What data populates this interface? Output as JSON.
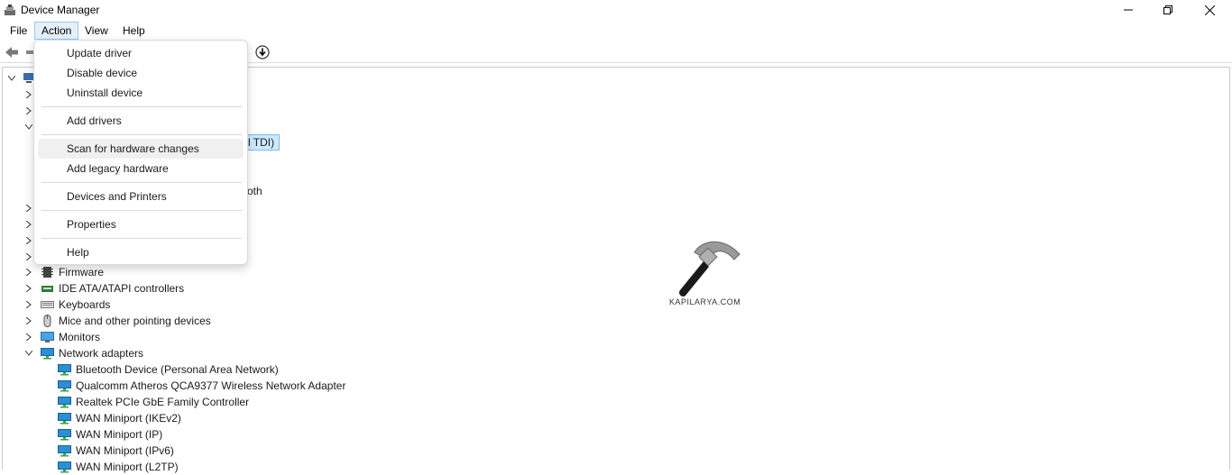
{
  "window": {
    "title": "Device Manager"
  },
  "menubar": {
    "file": "File",
    "action": "Action",
    "view": "View",
    "help": "Help"
  },
  "action_menu": {
    "update_driver": "Update driver",
    "disable_device": "Disable device",
    "uninstall_device": "Uninstall device",
    "add_drivers": "Add drivers",
    "scan_hardware": "Scan for hardware changes",
    "add_legacy": "Add legacy hardware",
    "devices_printers": "Devices and Printers",
    "properties": "Properties",
    "help": "Help"
  },
  "partial_text": {
    "selected_fragment": "l TDI)",
    "bluetooth_fragment": "oth"
  },
  "tree": {
    "firmware": "Firmware",
    "ide": "IDE ATA/ATAPI controllers",
    "keyboards": "Keyboards",
    "mice": "Mice and other pointing devices",
    "monitors": "Monitors",
    "network_adapters": "Network adapters",
    "network_children": [
      "Bluetooth Device (Personal Area Network)",
      "Qualcomm Atheros QCA9377 Wireless Network Adapter",
      "Realtek PCIe GbE Family Controller",
      "WAN Miniport (IKEv2)",
      "WAN Miniport (IP)",
      "WAN Miniport (IPv6)",
      "WAN Miniport (L2TP)"
    ]
  },
  "watermark": {
    "text": "KAPILARYA.COM"
  },
  "icons": {
    "app": "device-manager-icon",
    "back": "back-arrow-icon",
    "update": "update-driver-icon",
    "network": "network-adapter-icon"
  },
  "colors": {
    "selection": "#cce8ff",
    "menu_active": "#e5f0fb",
    "network_icon": "#2b8fd6"
  }
}
